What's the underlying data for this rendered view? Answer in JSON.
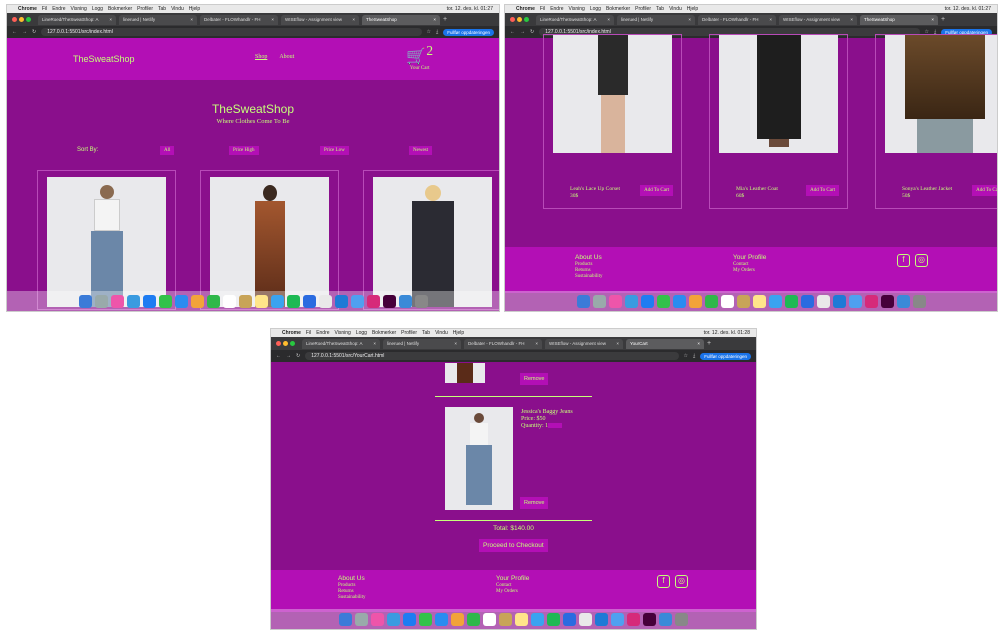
{
  "colors": {
    "page_bg": "#8a0f8c",
    "nav_bg": "#b30fb5",
    "accent_text": "#c6ff7a",
    "card_border": "#b84ab8"
  },
  "macbar": {
    "app": "Chrome",
    "menus": [
      "Fil",
      "Endre",
      "Visning",
      "Logg",
      "Bokmerker",
      "Profiler",
      "Tab",
      "Vindu",
      "Hjelp"
    ],
    "clock1": "tor. 12. des. kl. 01:27",
    "clock2": "tor. 12. des. kl. 01:28"
  },
  "tabs": [
    "LineRoed/TheSweatShop: A",
    "linerued | Netlify",
    "Delbater - FLOWhandlr - FH",
    "WISEflow - Assignment view",
    "TheSweatShop"
  ],
  "tabs_cart": [
    "LineRoed/TheSweatShop: A",
    "linerued | Netlify",
    "Delbater - FLOWhandlr - FH",
    "WISEflow - Assignment view",
    "YourCart"
  ],
  "browser": {
    "url_index": "127.0.0.1:5501/src/index.html",
    "url_cart": "127.0.0.1:5501/src/YourCart.html",
    "update_label": "Fullfør oppdateringen"
  },
  "nav": {
    "brand": "TheSweatShop",
    "links": [
      "Shop",
      "About"
    ],
    "cart_label": "Your Cart",
    "cart_count": "2"
  },
  "hero": {
    "title": "TheSweatShop",
    "subtitle": "Where Clothes Come To Be"
  },
  "sort": {
    "label": "Sort By:",
    "options": [
      "All",
      "Price High",
      "Price Low",
      "Newest"
    ]
  },
  "products": [
    {
      "name": "Leah's Lace Up Corset",
      "price": "30$"
    },
    {
      "name": "Mia's Leather Coat",
      "price": "60$"
    },
    {
      "name": "Sonya's Leather Jacket",
      "price": "50$"
    }
  ],
  "add_to_cart": "Add To Cart",
  "footer": {
    "col1_title": "About Us",
    "col1_links": [
      "Products",
      "Returns",
      "Sustainability"
    ],
    "col2_title": "Your Profile",
    "col2_links": [
      "Contact",
      "My Orders"
    ]
  },
  "cart": {
    "remove_label": "Remove",
    "item": {
      "name": "Jessica's Baggy Jeans",
      "price": "Price: $50",
      "quantity": "Quantity: 1"
    },
    "total": "Total: $140.00",
    "checkout_label": "Proceed to Checkout"
  }
}
